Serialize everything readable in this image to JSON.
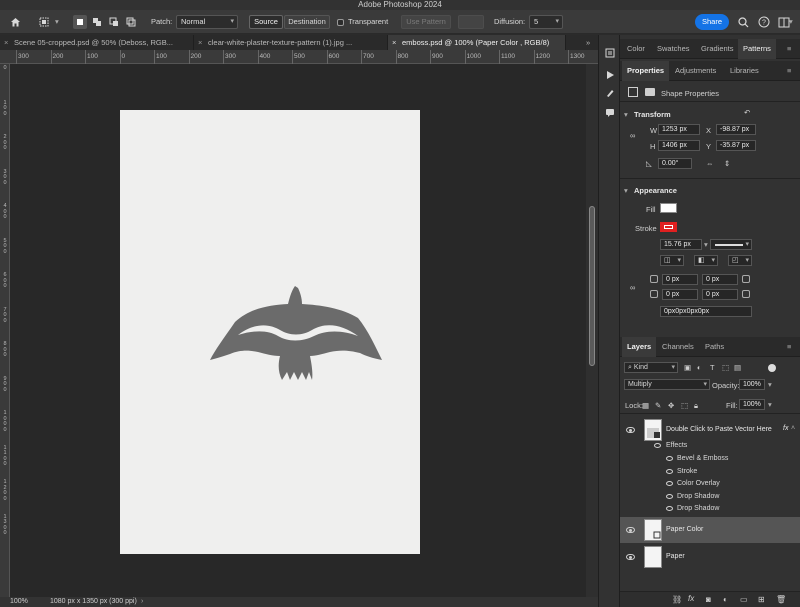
{
  "app": {
    "title": "Adobe Photoshop 2024"
  },
  "options_bar": {
    "patch_label": "Patch:",
    "patch_value": "Normal",
    "source_label": "Source",
    "destination_label": "Destination",
    "transparent_label": "Transparent",
    "use_pattern_label": "Use Pattern",
    "diffusion_label": "Diffusion:",
    "diffusion_value": "5",
    "share_label": "Share"
  },
  "tabs": [
    {
      "label": "Scene 05-cropped.psd @ 50% (Deboss, RGB..."
    },
    {
      "label": "clear-white-plaster-texture-pattern (1).jpg ..."
    },
    {
      "label": "emboss.psd @ 100% (Paper Color , RGB/8)"
    }
  ],
  "ruler": {
    "h_ticks": [
      "300",
      "200",
      "100",
      "0",
      "100",
      "200",
      "300",
      "400",
      "500",
      "600",
      "700",
      "800",
      "900",
      "1000",
      "1100",
      "1200",
      "1300",
      "1400"
    ],
    "v_ticks": [
      "0",
      "1\n0\n0",
      "2\n0\n0",
      "3\n0\n0",
      "4\n0\n0",
      "5\n0\n0",
      "6\n0\n0",
      "7\n0\n0",
      "8\n0\n0",
      "9\n0\n0",
      "1\n0\n0\n0",
      "1\n1\n0\n0",
      "1\n2\n0\n0",
      "1\n3\n0\n0"
    ]
  },
  "status": {
    "zoom": "100%",
    "doc_info": "1080 px x 1350 px (300 ppi)"
  },
  "top_panel_tabs": [
    "Color",
    "Swatches",
    "Gradients",
    "Patterns"
  ],
  "props_tabs": [
    "Properties",
    "Adjustments",
    "Libraries"
  ],
  "properties": {
    "header": "Shape Properties",
    "transform_title": "Transform",
    "w_label": "W",
    "w_value": "1253 px",
    "x_label": "X",
    "x_value": "-98.87 px",
    "h_label": "H",
    "h_value": "1406 px",
    "y_label": "Y",
    "y_value": "-35.87 px",
    "angle_value": "0.00°",
    "appearance_title": "Appearance",
    "fill_label": "Fill",
    "stroke_label": "Stroke",
    "stroke_width": "15.76 px",
    "corner_values": [
      "0 px",
      "0 px",
      "0 px",
      "0 px"
    ],
    "corner_combined": "0px0px0px0px",
    "stroke_color": "#e02020"
  },
  "layers_tabs": [
    "Layers",
    "Channels",
    "Paths"
  ],
  "layers": {
    "filter_kind": "Kind",
    "blend_mode": "Multiply",
    "opacity_label": "Opacity:",
    "opacity_value": "100%",
    "lock_label": "Lock:",
    "fill_label": "Fill:",
    "fill_value": "100%",
    "items": [
      {
        "name": "Double Click to Paste Vector Here",
        "fx": "fx"
      },
      {
        "name": "Paper Color"
      },
      {
        "name": "Paper"
      }
    ],
    "effects_label": "Effects",
    "effects": [
      "Bevel & Emboss",
      "Stroke",
      "Color Overlay",
      "Drop Shadow",
      "Drop Shadow"
    ]
  },
  "colors": {
    "accent": "#1473e6",
    "bird": "#6b6b6b",
    "paper": "#efefee"
  }
}
